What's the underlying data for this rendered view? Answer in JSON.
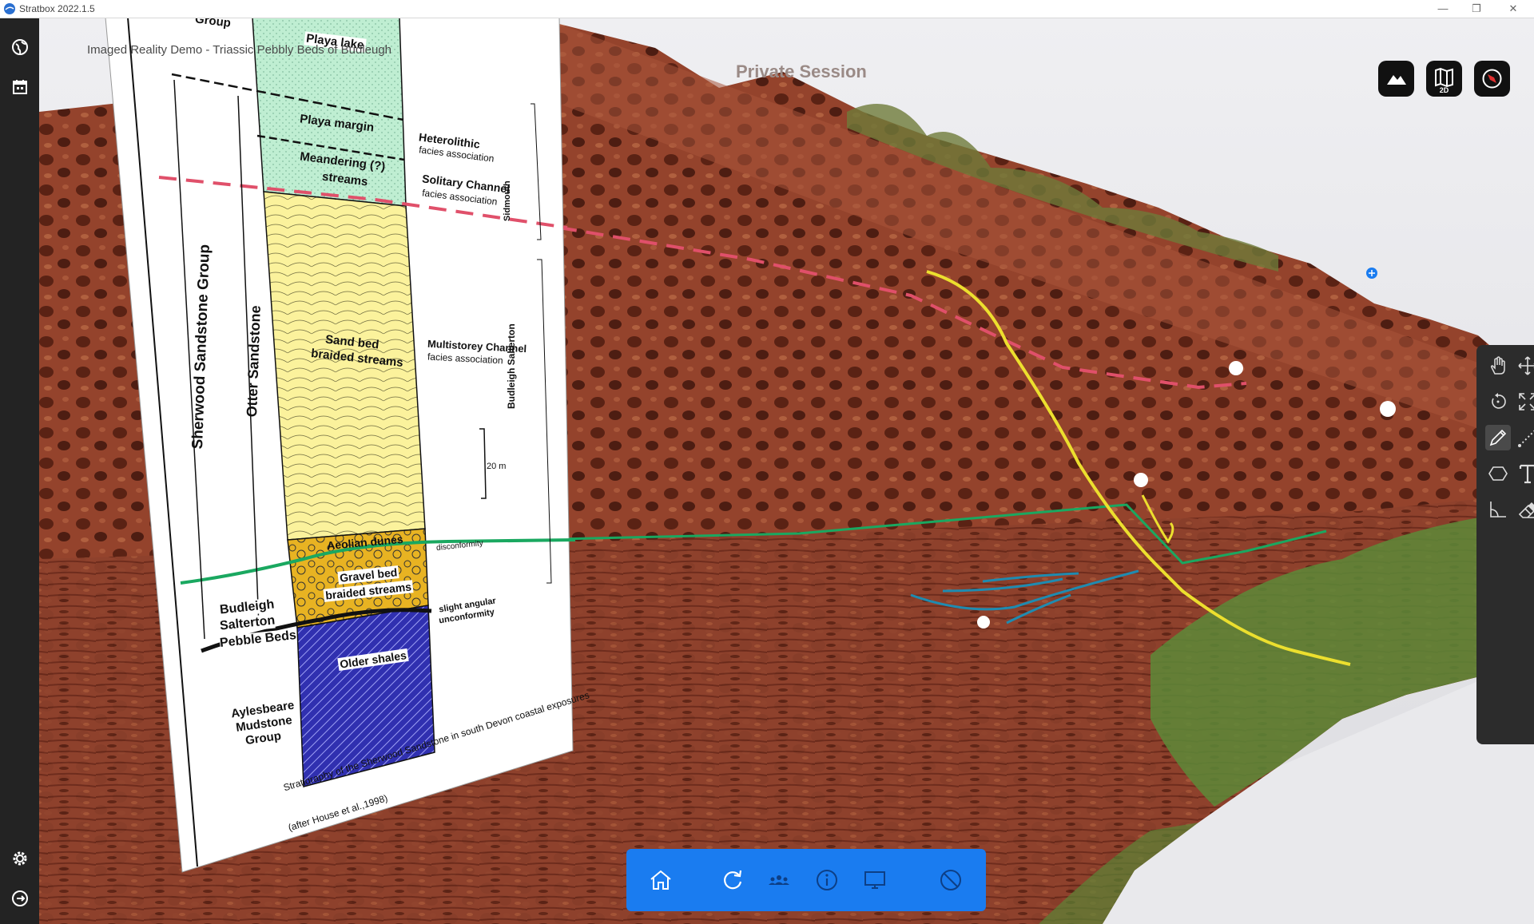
{
  "window": {
    "app_title": "Stratbox 2022.1.5",
    "controls": [
      "—",
      "❐",
      "✕"
    ]
  },
  "viewport": {
    "model_title": "Imaged Reality Demo - Triassic Pebbly Beds of Budleugh",
    "session_label": "Private Session",
    "view_buttons": [
      {
        "icon": "terrain-icon",
        "badge": ""
      },
      {
        "icon": "map-2d-icon",
        "badge": "2D"
      },
      {
        "icon": "compass-icon",
        "badge": ""
      }
    ]
  },
  "left_rail": {
    "top": [
      "globe-icon",
      "calendar-icon"
    ],
    "bottom": [
      "settings-icon",
      "logout-icon"
    ]
  },
  "toolbox": {
    "tools": [
      {
        "name": "pan-hand-tool",
        "icon": "hand-icon"
      },
      {
        "name": "move-tool",
        "icon": "move-arrows-icon"
      },
      {
        "name": "rotate-tool",
        "icon": "rotate-icon"
      },
      {
        "name": "fullscreen-tool",
        "icon": "expand-icon"
      },
      {
        "name": "pencil-tool",
        "icon": "pencil-icon",
        "active": true
      },
      {
        "name": "measure-line-tool",
        "icon": "dotted-line-icon"
      },
      {
        "name": "polygon-tool",
        "icon": "hexagon-icon"
      },
      {
        "name": "text-tool",
        "icon": "text-icon"
      },
      {
        "name": "angle-tool",
        "icon": "angle-icon"
      },
      {
        "name": "eraser-tool",
        "icon": "eraser-icon"
      }
    ]
  },
  "bottom_bar": {
    "buttons": [
      "home-icon",
      "refresh-icon",
      "group-icon",
      "info-icon",
      "monitor-icon",
      "block-icon"
    ]
  },
  "log_panel": {
    "group_top_label": "Group",
    "playa_lake": "Playa lake",
    "playa_margin": "Playa margin",
    "meandering": "Meandering (?)",
    "streams": "streams",
    "sand_bed": "Sand bed",
    "braided_streams": "braided streams",
    "aeolian_dunes": "Aeolian dunes",
    "gravel_bed": "Gravel bed",
    "gravel_braided": "braided streams",
    "older_shales": "Older shales",
    "heterolithic_1": "Heterolithic",
    "heterolithic_2": "facies association",
    "solitary_1": "Solitary Channel",
    "solitary_2": "facies association",
    "multistorey_1": "Multistorey Channel",
    "multistorey_2": "facies association",
    "disconformity": "disconformity",
    "slight_1": "slight angular",
    "slight_2": "unconformity",
    "scale": "20 m",
    "sidmouth": "Sidmouth",
    "budleigh_salterton": "Budleigh Salterton",
    "sherwood_group": "Sherwood Sandstone Group",
    "otter_sandstone": "Otter Sandstone",
    "pebble_beds_1": "Budleigh",
    "pebble_beds_2": "Salterton",
    "pebble_beds_3": "Pebble Beds",
    "aylesbeare_1": "Aylesbeare",
    "aylesbeare_2": "Mudstone",
    "aylesbeare_3": "Group",
    "caption_1": "Stratigraphy of the Sherwood Sandstone in south Devon coastal exposures",
    "caption_2": "(after House et al.,1998)"
  },
  "colors": {
    "accent": "#1a7cf0",
    "cliff": "#8a3e2a",
    "pink_line": "#e0506a",
    "green_line": "#1aa860",
    "yellow_line": "#ecdf2e",
    "blue_line": "#1f8bb0"
  }
}
